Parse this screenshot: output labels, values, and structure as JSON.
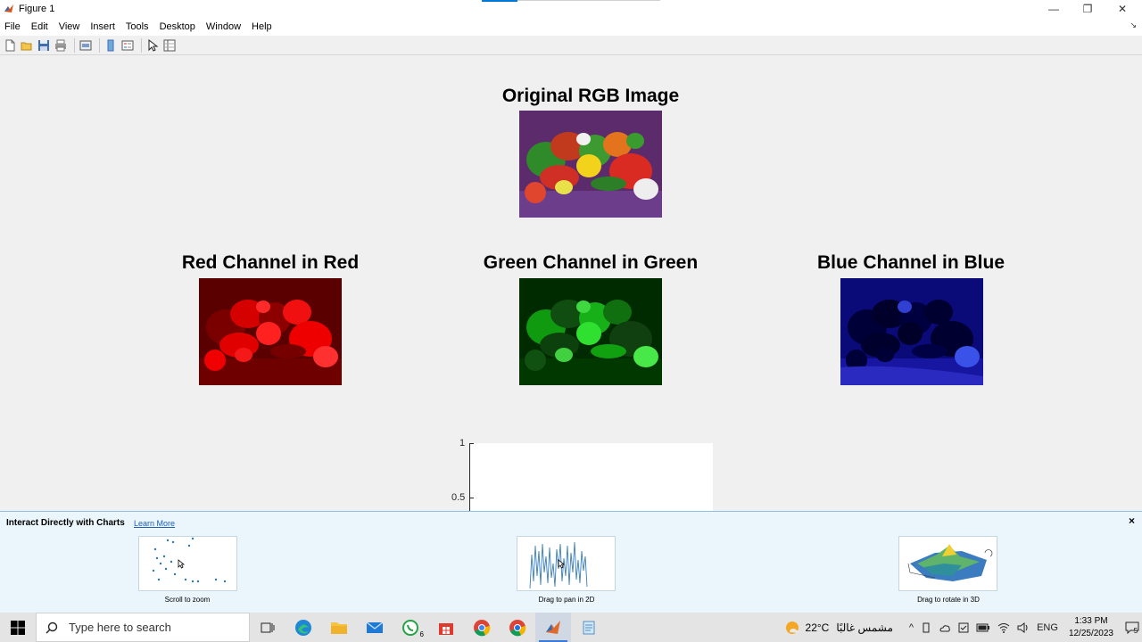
{
  "window": {
    "title": "Figure 1",
    "controls": {
      "minimize": "—",
      "restore": "❐",
      "close": "✕"
    }
  },
  "menu": {
    "items": [
      "File",
      "Edit",
      "View",
      "Insert",
      "Tools",
      "Desktop",
      "Window",
      "Help"
    ],
    "dock_arrow": "↘"
  },
  "toolbar": {
    "icons": [
      "new-figure-icon",
      "open-file-icon",
      "save-icon",
      "print-icon",
      "link-plot-icon",
      "insert-colorbar-icon",
      "insert-legend-icon",
      "edit-plot-arrow-icon",
      "property-inspector-icon"
    ]
  },
  "figure": {
    "subplots": [
      {
        "title": "Original RGB Image",
        "channel": "rgb"
      },
      {
        "title": "Red Channel in Red",
        "channel": "red"
      },
      {
        "title": "Green Channel in Green",
        "channel": "green"
      },
      {
        "title": "Blue Channel in Blue",
        "channel": "blue"
      }
    ],
    "axes": {
      "ytick_labels": [
        "1",
        "0.5"
      ]
    }
  },
  "banner": {
    "title": "Interact Directly with Charts",
    "link": "Learn More",
    "close": "×",
    "demos": [
      {
        "caption": "Scroll to zoom",
        "icon": "scatter-zoom-icon"
      },
      {
        "caption": "Drag to pan in 2D",
        "icon": "line-pan-icon"
      },
      {
        "caption": "Drag to rotate in 3D",
        "icon": "surface-rotate-icon"
      }
    ]
  },
  "taskbar": {
    "search_placeholder": "Type here to search",
    "apps": [
      "task-view-icon",
      "edge-icon",
      "file-explorer-icon",
      "mail-icon",
      "whatsapp-icon",
      "store-icon",
      "chrome-icon",
      "chrome-profile-icon",
      "matlab-icon",
      "notepad-icon"
    ],
    "whatsapp_badge": "6",
    "weather_temp": "22°C",
    "weather_text": "مشمس غالبًا",
    "language": "ENG",
    "time": "1:33 PM",
    "date": "12/25/2023",
    "notification_count": "5"
  },
  "colors": {
    "accent": "#0078d7",
    "banner_bg": "#eaf5fc",
    "taskbar_bg": "#e4e4e4"
  }
}
